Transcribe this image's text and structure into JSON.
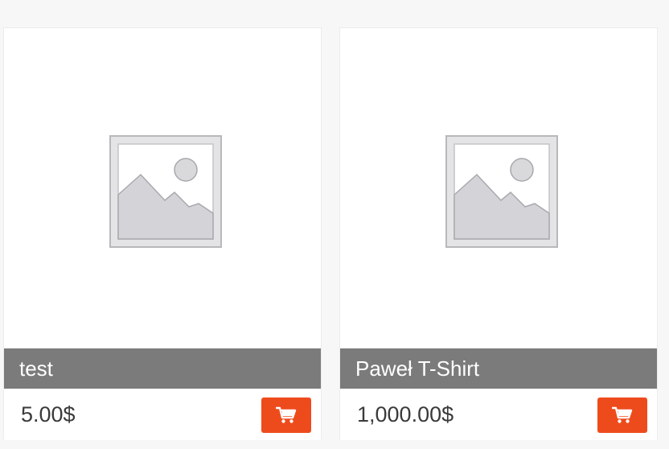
{
  "products": [
    {
      "title": "test",
      "price": "5.00$",
      "image_icon": "image-placeholder-icon",
      "cart_icon": "shopping-cart-icon"
    },
    {
      "title": "Paweł T-Shirt",
      "price": "1,000.00$",
      "image_icon": "image-placeholder-icon",
      "cart_icon": "shopping-cart-icon"
    }
  ],
  "colors": {
    "title_bar": "#7b7b7b",
    "cart_button": "#ee4b1d",
    "page_background": "#f7f7f7"
  }
}
